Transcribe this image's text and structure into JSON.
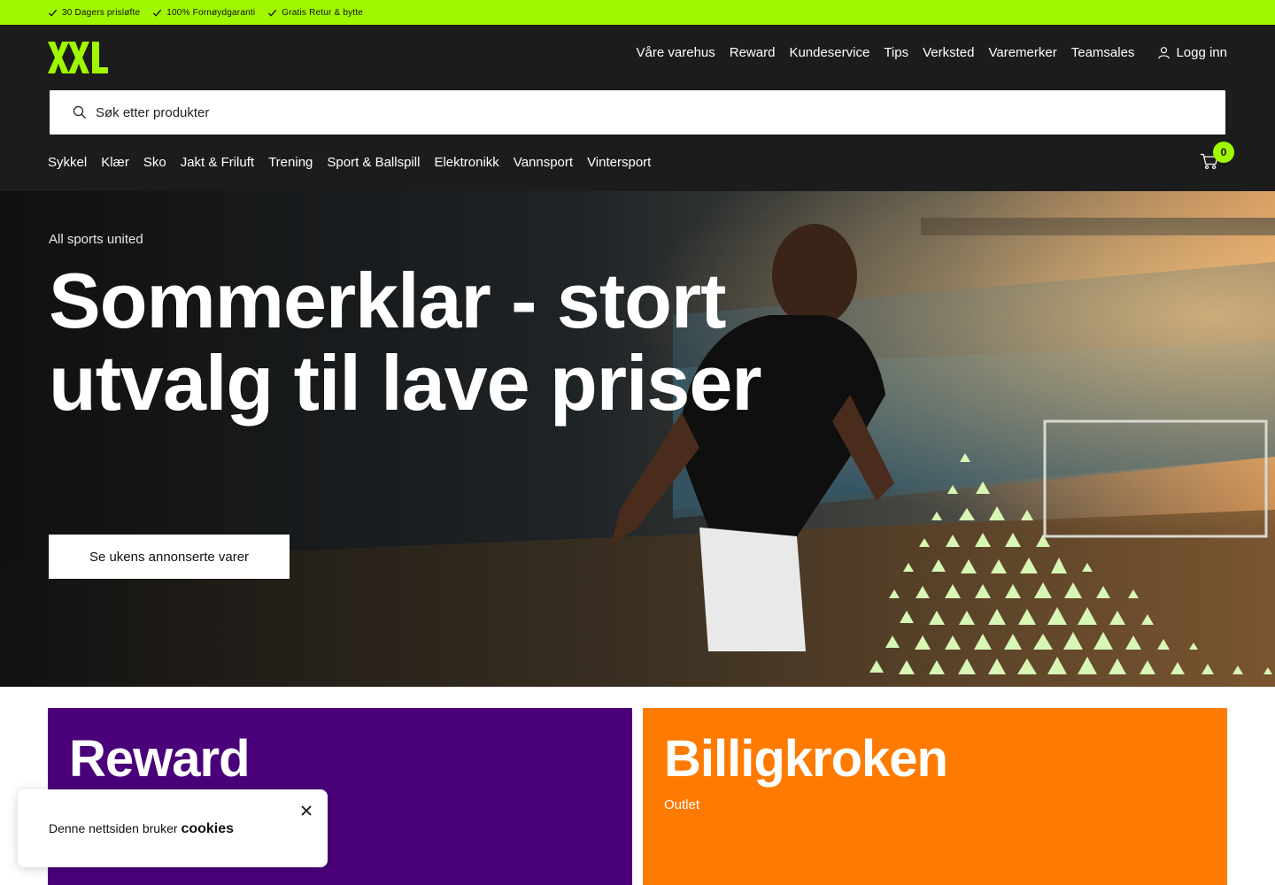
{
  "promo_bar": {
    "items": [
      "30 Dagers prisløfte",
      "100% Fornøydgaranti",
      "Gratis Retur & bytte"
    ],
    "icon": "check-icon"
  },
  "header": {
    "logo_text": "XXL",
    "top_nav": [
      "Våre varehus",
      "Reward",
      "Kundeservice",
      "Tips",
      "Verksted",
      "Varemerker",
      "Teamsales"
    ],
    "login_label": "Logg inn",
    "search_placeholder": "Søk etter produkter",
    "categories": [
      "Sykkel",
      "Klær",
      "Sko",
      "Jakt & Friluft",
      "Trening",
      "Sport & Ballspill",
      "Elektronikk",
      "Vannsport",
      "Vintersport"
    ],
    "cart_count": "0"
  },
  "hero": {
    "eyebrow": "All sports united",
    "title": "Sommerklar - stort utvalg til lave priser",
    "cta_label": "Se ukens annonserte varer"
  },
  "tiles": [
    {
      "title": "Reward",
      "subtitle": ""
    },
    {
      "title": "Billigkroken",
      "subtitle": "Outlet"
    }
  ],
  "cookie_banner": {
    "text": "Denne nettsiden bruker",
    "link_label": "cookies"
  },
  "colors": {
    "brand_green": "#a0f700",
    "header_bg": "#1c1c1c",
    "reward_purple": "#4a0079",
    "billig_orange": "#ff7a00"
  }
}
